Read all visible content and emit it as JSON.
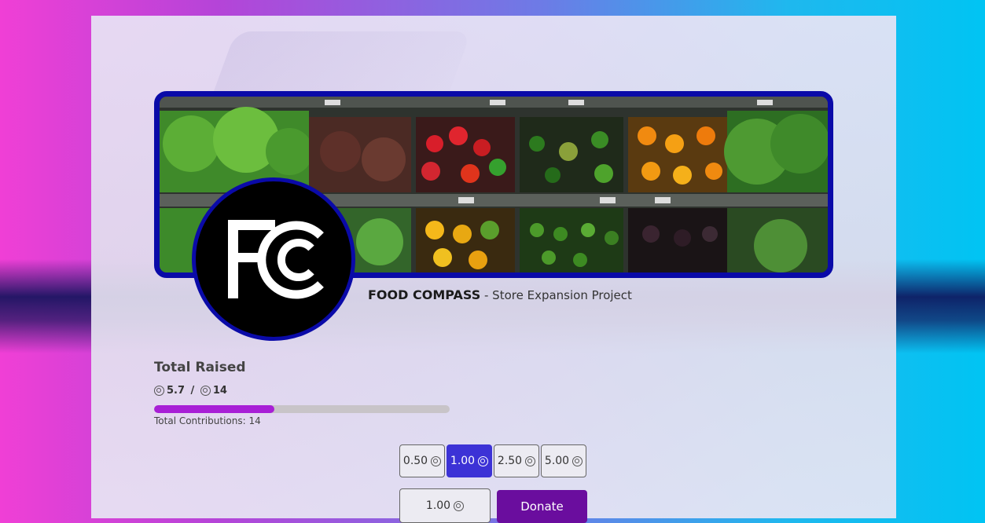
{
  "organization": {
    "name": "FOOD COMPASS",
    "separator": " - ",
    "project": "Store Expansion Project",
    "logo_text": "FC",
    "banner_icon": "grocery-shelves-image"
  },
  "fundraising": {
    "title": "Total Raised",
    "raised": "5.7",
    "divider": " / ",
    "goal": "14",
    "progress_fraction": 0.407,
    "contributions_label": "Total Contributions: 14",
    "currency_icon": "coin-icon"
  },
  "donation": {
    "preset_amounts": [
      "0.50",
      "1.00",
      "2.50",
      "5.00"
    ],
    "selected_amount": "1.00",
    "custom_value": "1.00",
    "donate_label": "Donate"
  },
  "colors": {
    "accent_blue": "#0a0aa8",
    "progress_fill": "#a81fd6",
    "selected_amount_bg": "#3c32d6",
    "donate_bg": "#6a0d9e"
  }
}
